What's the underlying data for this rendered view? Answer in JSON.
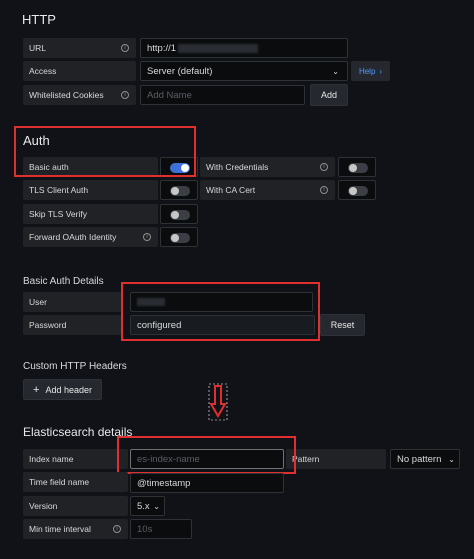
{
  "http": {
    "title": "HTTP",
    "url_label": "URL",
    "url_value": "http://1",
    "access_label": "Access",
    "access_value": "Server (default)",
    "help_label": "Help",
    "whitelisted_label": "Whitelisted Cookies",
    "whitelisted_placeholder": "Add Name",
    "add_label": "Add"
  },
  "auth": {
    "title": "Auth",
    "basic_auth_label": "Basic auth",
    "basic_auth_on": true,
    "with_credentials_label": "With Credentials",
    "with_credentials_on": false,
    "tls_client_auth_label": "TLS Client Auth",
    "tls_client_auth_on": false,
    "with_ca_cert_label": "With CA Cert",
    "with_ca_cert_on": false,
    "skip_tls_label": "Skip TLS Verify",
    "skip_tls_on": false,
    "forward_oauth_label": "Forward OAuth Identity",
    "forward_oauth_on": false
  },
  "basic_auth_details": {
    "title": "Basic Auth Details",
    "user_label": "User",
    "password_label": "Password",
    "password_value": "configured",
    "reset_label": "Reset"
  },
  "custom_headers": {
    "title": "Custom HTTP Headers",
    "add_header_label": "Add header"
  },
  "elasticsearch": {
    "title": "Elasticsearch details",
    "index_name_label": "Index name",
    "index_name_placeholder": "es-index-name",
    "pattern_label": "Pattern",
    "pattern_value": "No pattern",
    "time_field_label": "Time field name",
    "time_field_value": "@timestamp",
    "version_label": "Version",
    "version_value": "5.x",
    "min_time_label": "Min time interval",
    "min_time_placeholder": "10s"
  },
  "colors": {
    "background": "#111217",
    "annotation_red": "#e02f2f",
    "toggle_on": "#3d71d9",
    "link_blue": "#4f9bff"
  }
}
